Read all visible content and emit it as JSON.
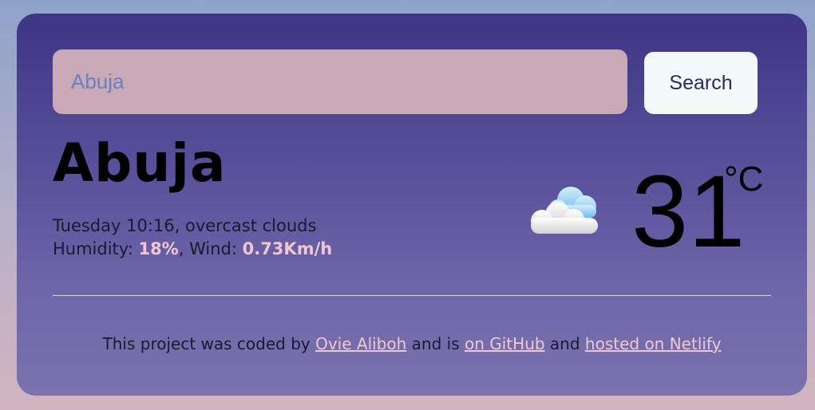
{
  "search": {
    "value": "Abuja",
    "button_label": "Search"
  },
  "weather": {
    "city": "Abuja",
    "date_description": "Tuesday 10:16, overcast clouds",
    "humidity_label": "Humidity: ",
    "humidity_value": "18%",
    "wind_label": ", Wind: ",
    "wind_value": "0.73Km/h",
    "temperature": "31",
    "unit": "°C",
    "icon": "cloud-icon"
  },
  "footer": {
    "text_before": "This project was coded by ",
    "author_link": "Ovie Aliboh",
    "text_middle": " and is ",
    "github_link": "on GitHub",
    "text_and": " and ",
    "netlify_link": "hosted on Netlify"
  },
  "colors": {
    "card_top": "#3d3585",
    "card_bottom": "#7a72ad",
    "input_bg": "#c8a9b5",
    "highlight": "#f1c6d3"
  }
}
